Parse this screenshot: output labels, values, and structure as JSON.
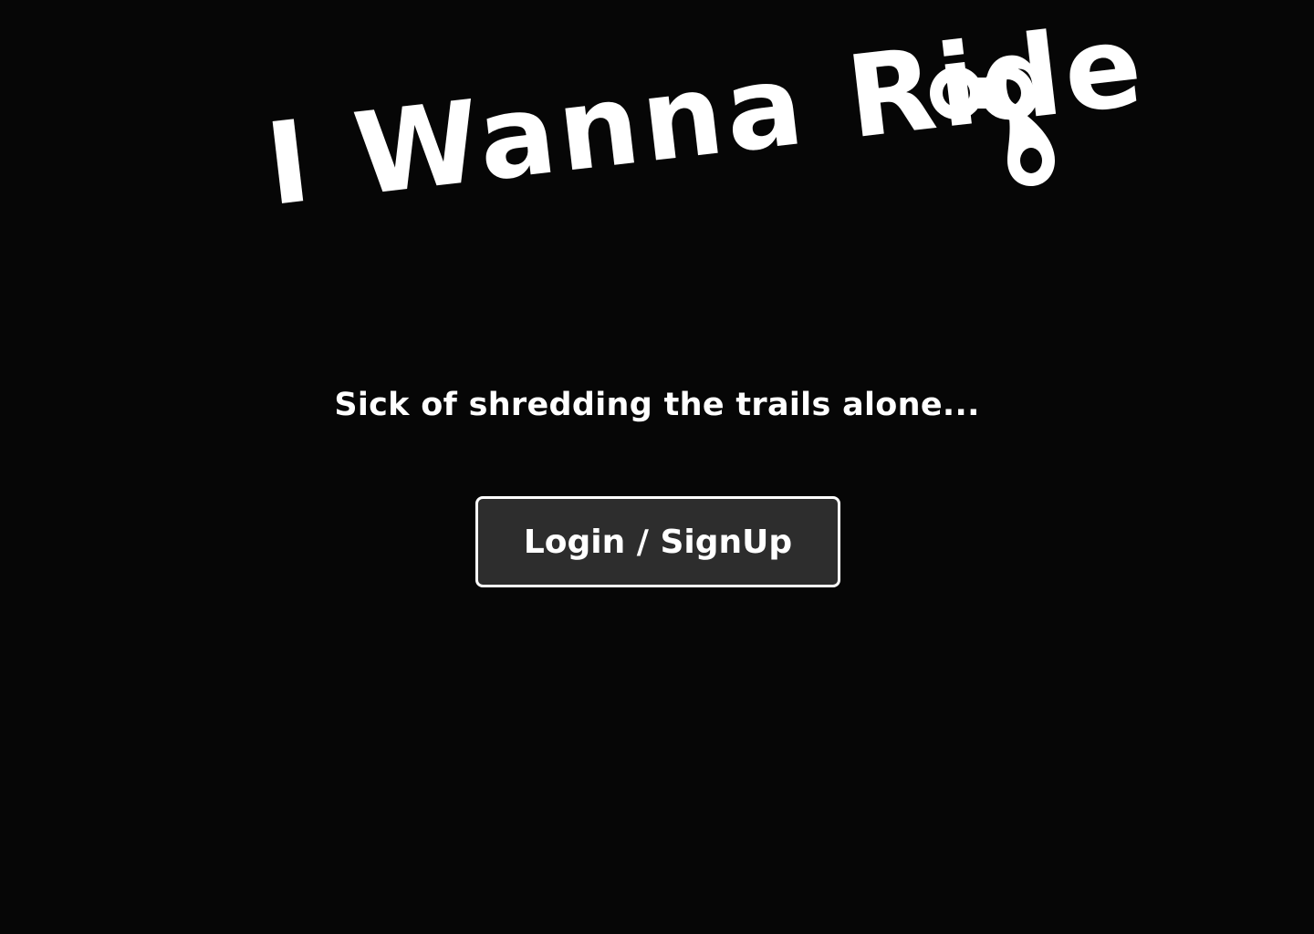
{
  "logo": {
    "title": "I Wanna Ride",
    "icon": "bike-chain-link-icon"
  },
  "tagline": "Sick of shredding the trails alone...",
  "login_button": {
    "label": "Login / SignUp"
  },
  "colors": {
    "background": "#060606",
    "text": "#ffffff",
    "button_background": "#2d2d2d",
    "button_border": "#ffffff"
  }
}
